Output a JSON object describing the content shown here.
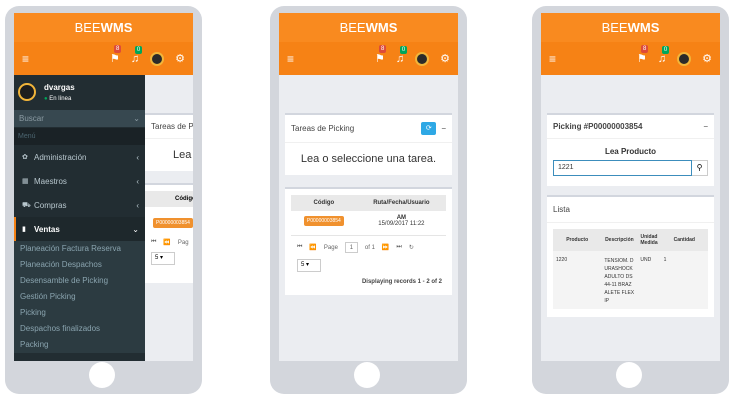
{
  "brand": {
    "prefix": "BEE",
    "suffix": "WMS"
  },
  "navbar": {
    "menu_icon": "≡",
    "badge_flag": "8",
    "badge_bell": "0"
  },
  "phone1": {
    "user": {
      "name": "dvargas",
      "status": "En línea"
    },
    "search_placeholder": "Buscar",
    "menu_header": "Menú",
    "menu": [
      {
        "label": "Administración",
        "icon": "gear-icon"
      },
      {
        "label": "Maestros",
        "icon": "table-icon"
      },
      {
        "label": "Compras",
        "icon": "cart-icon"
      },
      {
        "label": "Ventas",
        "icon": "briefcase-icon"
      }
    ],
    "submenu": [
      "Planeación Factura Reserva",
      "Planeación Despachos",
      "Desensamble de Picking",
      "Gestión Picking",
      "Picking",
      "Despachos finalizados",
      "Packing"
    ],
    "panel_title": "Tareas de Pickin",
    "lea": "Lea o s",
    "col_codigo": "Código",
    "code": "P00000003854",
    "pager_label": "Pag",
    "page_size": "5"
  },
  "phone2": {
    "panel_title": "Tareas de Picking",
    "lea": "Lea o seleccione una tarea.",
    "col_codigo": "Código",
    "col_ruta": "Ruta/Fecha/Usuario",
    "row": {
      "code": "P00000003854",
      "ruta": "AM",
      "fecha": "15/09/2017 11:22"
    },
    "pager": {
      "page_label": "Page",
      "page": "1",
      "of": "of 1"
    },
    "page_size": "5",
    "displaying": "Displaying records 1 - 2 of 2"
  },
  "phone3": {
    "picking_title": "Picking #P00000003854",
    "lea_producto": "Lea Producto",
    "input_value": "1221",
    "lista": "Lista",
    "columns": [
      "Producto",
      "Descripción",
      "Unidad Medida",
      "Cantidad"
    ],
    "row": {
      "producto": "1220",
      "descripcion": "TENSIOM. DURASHOCK ADULTO DS44-11 BRAZALETE FLEXIP",
      "unidad": "UND",
      "cantidad": "1"
    }
  },
  "colors": {
    "orange": "#f68215",
    "sidebar": "#222d32"
  }
}
